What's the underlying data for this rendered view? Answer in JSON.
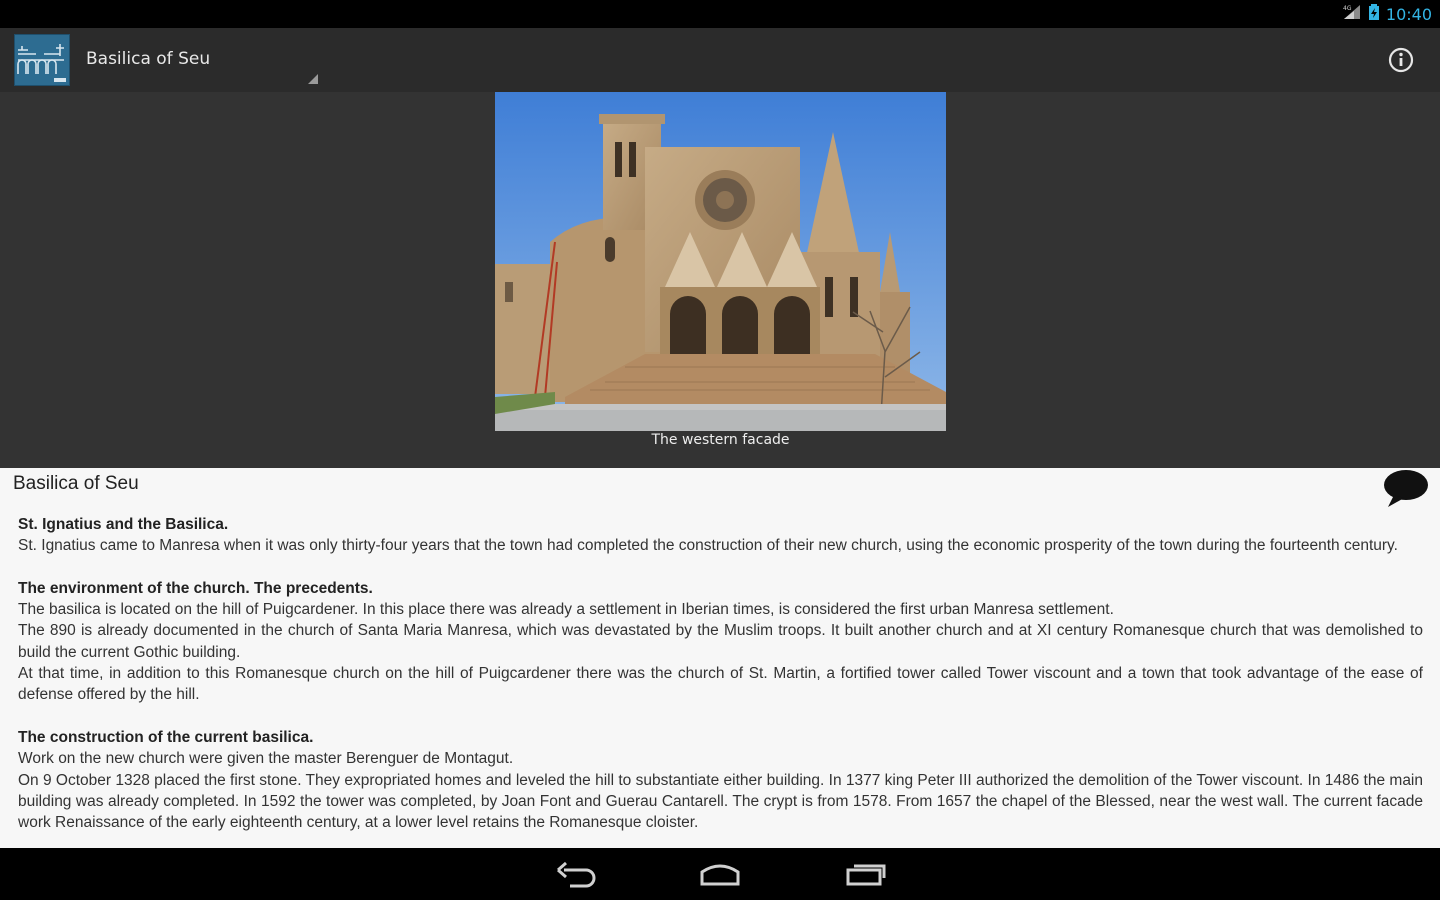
{
  "status_bar": {
    "time": "10:40",
    "icons": [
      "signal-icon",
      "battery-icon"
    ]
  },
  "action_bar": {
    "title": "Basilica of Seu",
    "icons": [
      "app-logo",
      "info-icon"
    ]
  },
  "hero": {
    "caption": "The western facade"
  },
  "content": {
    "title": "Basilica of Seu",
    "sections": [
      {
        "heading": "St. Ignatius and the Basilica.",
        "paragraphs": [
          "St. Ignatius came to Manresa when it was only thirty-four years that the town had completed the construction of their new church, using the economic prosperity of the town during the fourteenth century."
        ]
      },
      {
        "heading": "The environment of the church. The precedents.",
        "paragraphs": [
          "The basilica is located on the hill of Puigcardener. In this place there was already a settlement in Iberian times, is considered the first urban Manresa settlement.",
          "The 890 is already documented in the church of Santa Maria Manresa, which was devastated by the Muslim troops. It built another church and at XI century Romanesque church that was demolished to build the current Gothic building.",
          "At that time, in addition to this Romanesque church on the hill of Puigcardener there was the church of St. Martin, a fortified tower called Tower viscount and a town that took advantage of the ease of defense offered by the hill."
        ]
      },
      {
        "heading": "The construction of the current basilica.",
        "paragraphs": [
          "Work on the new church were given the master Berenguer de Montagut.",
          "On 9 October 1328 placed the first stone. They expropriated homes and leveled the hill to substantiate either building. In 1377 king Peter III authorized the demolition of the Tower viscount. In 1486 the main building was already completed. In 1592 the tower was completed, by Joan Font and Guerau Cantarell. The crypt is from 1578. From 1657 the chapel of the Blessed, near the west wall. The current facade work Renaissance of the early eighteenth century, at a lower level retains the Romanesque cloister."
        ]
      }
    ],
    "icons": [
      "comment-icon"
    ]
  },
  "nav_bar": {
    "icons": [
      "back-icon",
      "home-icon",
      "recent-apps-icon"
    ]
  },
  "colors": {
    "status_accent": "#33b5e5",
    "action_bar_bg": "#2b2b2b",
    "hero_bg": "#333333",
    "content_bg": "#f7f7f7"
  }
}
